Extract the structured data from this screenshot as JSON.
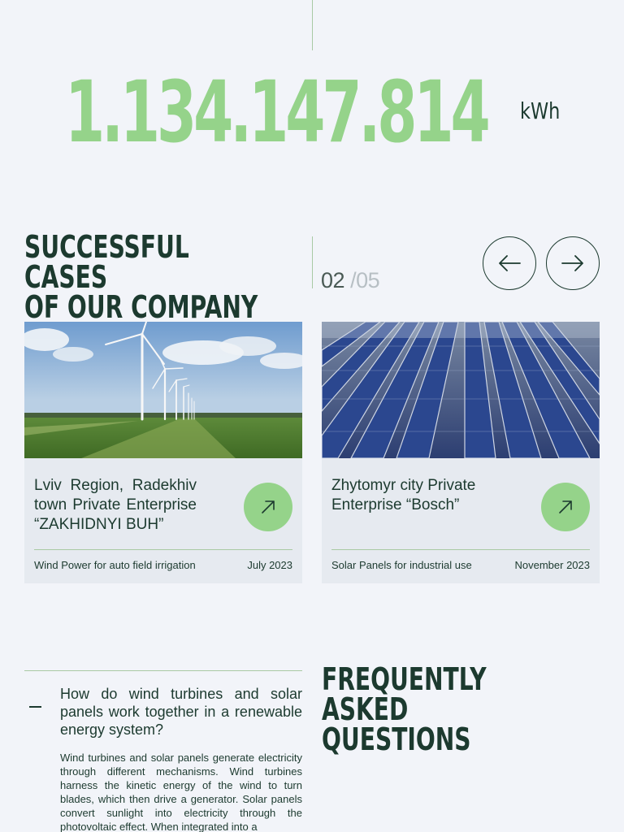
{
  "stats": {
    "energy_value": "1.134.147.814",
    "energy_unit": "kWh"
  },
  "cases": {
    "title_line1": "SUCCESSFUL CASES",
    "title_line2": "OF OUR COMPANY",
    "pager": {
      "current": "02",
      "separator": "/",
      "total": "05"
    },
    "prev_icon": "arrow-left-icon",
    "next_icon": "arrow-right-icon",
    "items": [
      {
        "image": "wind-turbines-field-image",
        "title": "Lviv Region, Radekhiv town Private Enterprise “ZAKHIDNYI BUH”",
        "description": "Wind Power for auto field irrigation",
        "date": "July 2023",
        "icon": "arrow-up-right-icon"
      },
      {
        "image": "solar-panels-roof-image",
        "title": "Zhytomyr city Private Enterprise “Bosch”",
        "description": "Solar Panels for industrial use",
        "date": "November 2023",
        "icon": "arrow-up-right-icon"
      }
    ]
  },
  "faq": {
    "title_line1": "FREQUENTLY ASKED",
    "title_line2": "QUESTIONS",
    "items": [
      {
        "question": "How do wind turbines and solar panels work together in a renewable energy system?",
        "answer": "Wind turbines and solar panels generate electricity through different mechanisms. Wind turbines harness the kinetic energy of the wind to turn blades, which then drive a generator. Solar panels convert sunlight into electricity through the photovoltaic effect. When integrated into a",
        "toggle_icon": "minus-icon"
      }
    ]
  },
  "colors": {
    "accent_green": "#95d38a",
    "dark_green": "#1c3a2f",
    "background": "#f2f4f9",
    "card_background": "#e6eaf0"
  }
}
